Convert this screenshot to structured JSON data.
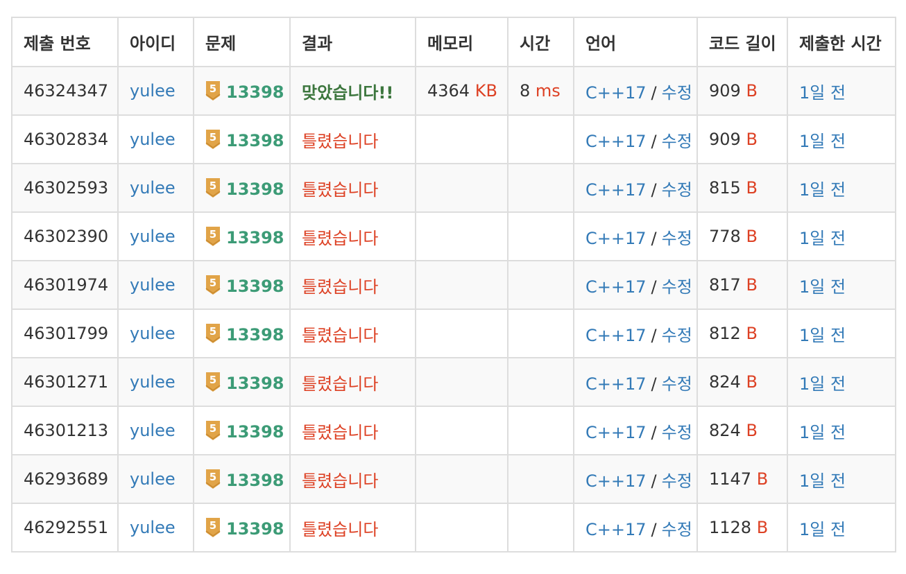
{
  "headers": [
    "제출 번호",
    "아이디",
    "문제",
    "결과",
    "메모리",
    "시간",
    "언어",
    "코드 길이",
    "제출한 시간"
  ],
  "tier_badge": {
    "icon": "tier-badge-icon",
    "label": "5",
    "color": "#e1a448"
  },
  "colors": {
    "link": "#337ab7",
    "accepted": "#3c763d",
    "wrong": "#dd4124",
    "problem": "#3c9b76"
  },
  "rows": [
    {
      "id": "46324347",
      "user": "yulee",
      "problem": "13398",
      "result": "맞았습니다!!",
      "result_type": "accepted",
      "memory": "4364",
      "memory_unit": "KB",
      "time": "8",
      "time_unit": "ms",
      "lang": "C++17",
      "edit": "수정",
      "length": "909",
      "length_unit": "B",
      "submitted": "1일 전"
    },
    {
      "id": "46302834",
      "user": "yulee",
      "problem": "13398",
      "result": "틀렸습니다",
      "result_type": "wrong",
      "memory": "",
      "memory_unit": "",
      "time": "",
      "time_unit": "",
      "lang": "C++17",
      "edit": "수정",
      "length": "909",
      "length_unit": "B",
      "submitted": "1일 전"
    },
    {
      "id": "46302593",
      "user": "yulee",
      "problem": "13398",
      "result": "틀렸습니다",
      "result_type": "wrong",
      "memory": "",
      "memory_unit": "",
      "time": "",
      "time_unit": "",
      "lang": "C++17",
      "edit": "수정",
      "length": "815",
      "length_unit": "B",
      "submitted": "1일 전"
    },
    {
      "id": "46302390",
      "user": "yulee",
      "problem": "13398",
      "result": "틀렸습니다",
      "result_type": "wrong",
      "memory": "",
      "memory_unit": "",
      "time": "",
      "time_unit": "",
      "lang": "C++17",
      "edit": "수정",
      "length": "778",
      "length_unit": "B",
      "submitted": "1일 전"
    },
    {
      "id": "46301974",
      "user": "yulee",
      "problem": "13398",
      "result": "틀렸습니다",
      "result_type": "wrong",
      "memory": "",
      "memory_unit": "",
      "time": "",
      "time_unit": "",
      "lang": "C++17",
      "edit": "수정",
      "length": "817",
      "length_unit": "B",
      "submitted": "1일 전"
    },
    {
      "id": "46301799",
      "user": "yulee",
      "problem": "13398",
      "result": "틀렸습니다",
      "result_type": "wrong",
      "memory": "",
      "memory_unit": "",
      "time": "",
      "time_unit": "",
      "lang": "C++17",
      "edit": "수정",
      "length": "812",
      "length_unit": "B",
      "submitted": "1일 전"
    },
    {
      "id": "46301271",
      "user": "yulee",
      "problem": "13398",
      "result": "틀렸습니다",
      "result_type": "wrong",
      "memory": "",
      "memory_unit": "",
      "time": "",
      "time_unit": "",
      "lang": "C++17",
      "edit": "수정",
      "length": "824",
      "length_unit": "B",
      "submitted": "1일 전"
    },
    {
      "id": "46301213",
      "user": "yulee",
      "problem": "13398",
      "result": "틀렸습니다",
      "result_type": "wrong",
      "memory": "",
      "memory_unit": "",
      "time": "",
      "time_unit": "",
      "lang": "C++17",
      "edit": "수정",
      "length": "824",
      "length_unit": "B",
      "submitted": "1일 전"
    },
    {
      "id": "46293689",
      "user": "yulee",
      "problem": "13398",
      "result": "틀렸습니다",
      "result_type": "wrong",
      "memory": "",
      "memory_unit": "",
      "time": "",
      "time_unit": "",
      "lang": "C++17",
      "edit": "수정",
      "length": "1147",
      "length_unit": "B",
      "submitted": "1일 전"
    },
    {
      "id": "46292551",
      "user": "yulee",
      "problem": "13398",
      "result": "틀렸습니다",
      "result_type": "wrong",
      "memory": "",
      "memory_unit": "",
      "time": "",
      "time_unit": "",
      "lang": "C++17",
      "edit": "수정",
      "length": "1128",
      "length_unit": "B",
      "submitted": "1일 전"
    }
  ]
}
